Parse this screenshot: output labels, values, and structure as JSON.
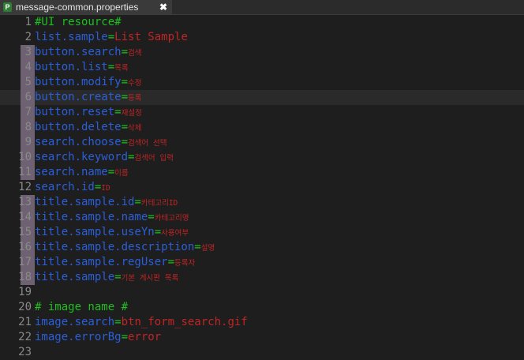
{
  "tab": {
    "icon_letter": "P",
    "title": "message-common.properties",
    "close_symbol": "✖"
  },
  "lines": [
    {
      "num": "1",
      "comment": "#UI resource#",
      "marked": false
    },
    {
      "num": "2",
      "key": "list.sample",
      "eq": "=",
      "value": "List Sample",
      "small": false,
      "marked": false
    },
    {
      "num": "3",
      "key": "button.search",
      "eq": "=",
      "value": "검색",
      "small": true,
      "marked": true
    },
    {
      "num": "4",
      "key": "button.list",
      "eq": "=",
      "value": "목록",
      "small": true,
      "marked": true
    },
    {
      "num": "5",
      "key": "button.modify",
      "eq": "=",
      "value": "수정",
      "small": true,
      "marked": true
    },
    {
      "num": "6",
      "key": "button.create",
      "eq": "=",
      "value": "등록",
      "small": true,
      "marked": true,
      "current": true
    },
    {
      "num": "7",
      "key": "button.reset",
      "eq": "=",
      "value": "재설정",
      "small": true,
      "marked": true
    },
    {
      "num": "8",
      "key": "button.delete",
      "eq": "=",
      "value": "삭제",
      "small": true,
      "marked": true
    },
    {
      "num": "9",
      "key": "search.choose",
      "eq": "=",
      "value": "검색어 선택",
      "small": true,
      "marked": true
    },
    {
      "num": "10",
      "key": "search.keyword",
      "eq": "=",
      "value": "검색어 입력",
      "small": true,
      "marked": true
    },
    {
      "num": "11",
      "key": "search.name",
      "eq": "=",
      "value": "이름",
      "small": true,
      "marked": true
    },
    {
      "num": "12",
      "key": "search.id",
      "eq": "=",
      "value": "ID",
      "small": true,
      "marked": false
    },
    {
      "num": "13",
      "key": "title.sample.id",
      "eq": "=",
      "value": "카테고리ID",
      "small": true,
      "marked": true
    },
    {
      "num": "14",
      "key": "title.sample.name",
      "eq": "=",
      "value": "카테고리명",
      "small": true,
      "marked": true
    },
    {
      "num": "15",
      "key": "title.sample.useYn",
      "eq": "=",
      "value": "사용여부",
      "small": true,
      "marked": true
    },
    {
      "num": "16",
      "key": "title.sample.description",
      "eq": "=",
      "value": "설명",
      "small": true,
      "marked": true
    },
    {
      "num": "17",
      "key": "title.sample.regUser",
      "eq": "=",
      "value": "등록자",
      "small": true,
      "marked": true
    },
    {
      "num": "18",
      "key": "title.sample",
      "eq": "=",
      "value": "기본 게시판 목록",
      "small": true,
      "marked": true
    },
    {
      "num": "19",
      "blank": true,
      "marked": false
    },
    {
      "num": "20",
      "comment": "# image name #",
      "marked": false
    },
    {
      "num": "21",
      "key": "image.search",
      "eq": "=",
      "value": "btn_form_search.gif",
      "small": false,
      "marked": false
    },
    {
      "num": "22",
      "key": "image.errorBg",
      "eq": "=",
      "value": "error",
      "small": false,
      "marked": false
    },
    {
      "num": "23",
      "blank": true,
      "marked": false
    }
  ],
  "colors": {
    "background": "#1e1e1e",
    "comment": "#1fbf1f",
    "key": "#2b5fd9",
    "value": "#c12525",
    "line_number": "#8a8a8a",
    "gutter_mark": "#6e6272"
  }
}
